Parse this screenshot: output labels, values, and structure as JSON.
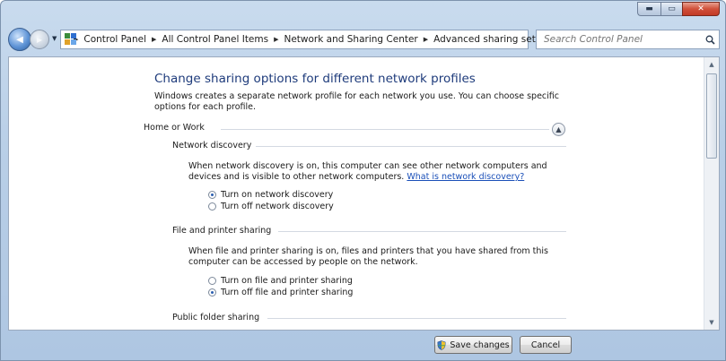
{
  "window": {
    "caption_buttons": {
      "minimize": "▬",
      "maximize": "▭",
      "close": "✕"
    }
  },
  "nav": {
    "back_glyph": "◀",
    "forward_glyph": "▶",
    "dropdown_glyph": "▼"
  },
  "address": {
    "crumbs": [
      "Control Panel",
      "All Control Panel Items",
      "Network and Sharing Center",
      "Advanced sharing settings"
    ],
    "separator": "▶",
    "dropdown_glyph": "▼",
    "refresh_glyph": "↻"
  },
  "search": {
    "placeholder": "Search Control Panel"
  },
  "main": {
    "title": "Change sharing options for different network profiles",
    "description": "Windows creates a separate network profile for each network you use. You can choose specific options for each profile.",
    "profile": {
      "label": "Home or Work",
      "collapse_glyph": "▲"
    },
    "network_discovery": {
      "heading": "Network discovery",
      "text": "When network discovery is on, this computer can see other network computers and devices and is visible to other network computers.",
      "link": "What is network discovery?",
      "options": [
        {
          "label": "Turn on network discovery",
          "checked": true
        },
        {
          "label": "Turn off network discovery",
          "checked": false
        }
      ]
    },
    "file_sharing": {
      "heading": "File and printer sharing",
      "text": "When file and printer sharing is on, files and printers that you have shared from this computer can be accessed by people on the network.",
      "options": [
        {
          "label": "Turn on file and printer sharing",
          "checked": false
        },
        {
          "label": "Turn off file and printer sharing",
          "checked": true
        }
      ]
    },
    "public_folder": {
      "heading": "Public folder sharing"
    }
  },
  "scrollbar": {
    "up_glyph": "▲",
    "down_glyph": "▼"
  },
  "buttons": {
    "save": "Save changes",
    "cancel": "Cancel"
  },
  "colors": {
    "title_blue": "#1e3b7b",
    "link_blue": "#1a4fb8",
    "chrome_blue": "#b9cfe7"
  }
}
